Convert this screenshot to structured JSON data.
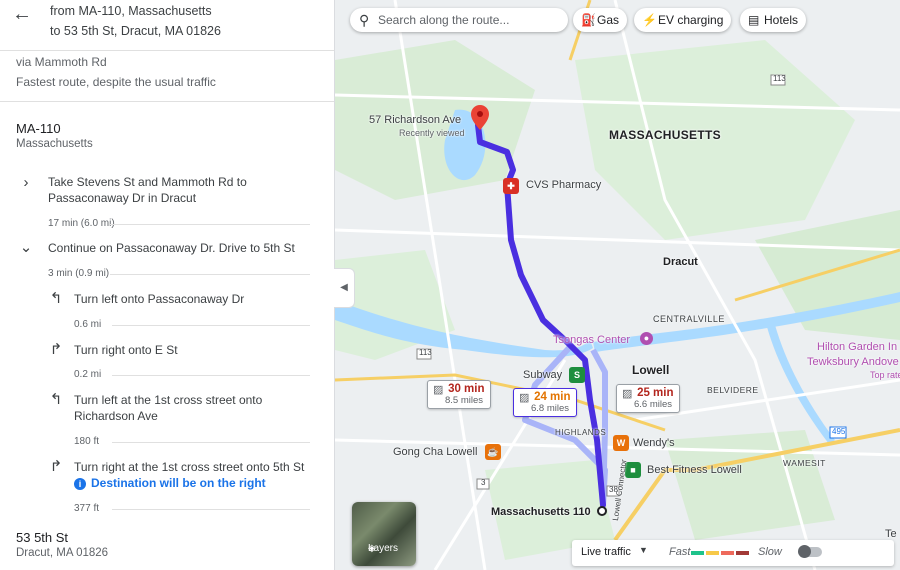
{
  "panel": {
    "back_icon": "arrow-left-icon",
    "from_text": "from MA-110, Massachusetts",
    "to_text": "to 53 5th St, Dracut, MA 01826",
    "via": "via Mammoth Rd",
    "route_note": "Fastest route, despite the usual traffic",
    "origin": {
      "title": "MA-110",
      "subtitle": "Massachusetts"
    },
    "steps": [
      {
        "icon": "chevron-right-icon",
        "text": "Take Stevens St and Mammoth Rd to Passaconaway Dr in Dracut",
        "meta": "17 min (6.0 mi)"
      },
      {
        "icon": "chevron-down-icon",
        "text": "Continue on Passaconaway Dr. Drive to 5th St",
        "meta": "3 min (0.9 mi)"
      }
    ],
    "substeps": [
      {
        "icon": "turn-left-icon",
        "text": "Turn left onto Passaconaway Dr",
        "dist": "0.6 mi"
      },
      {
        "icon": "turn-right-icon",
        "text": "Turn right onto E St",
        "dist": "0.2 mi"
      },
      {
        "icon": "turn-left-icon",
        "text": "Turn left at the 1st cross street onto Richardson Ave",
        "dist": "180 ft"
      },
      {
        "icon": "turn-right-icon",
        "text": "Turn right at the 1st cross street onto 5th St",
        "note": "Destination will be on the right",
        "dist": "377 ft"
      }
    ],
    "destination": {
      "title": "53 5th St",
      "subtitle": "Dracut, MA 01826"
    }
  },
  "map": {
    "search_placeholder": "Search along the route...",
    "chips": [
      {
        "icon": "gas-icon",
        "label": "Gas"
      },
      {
        "icon": "ev-charging-icon",
        "label": "EV charging"
      },
      {
        "icon": "hotel-icon",
        "label": "Hotels"
      }
    ],
    "labels": {
      "richardson": "57 Richardson Ave",
      "recently_viewed": "Recently viewed",
      "massachusetts": "MASSACHUSETTS",
      "cvs": "CVS Pharmacy",
      "dracut": "Dracut",
      "centralville": "CENTRALVILLE",
      "tsongas": "Tsongas Center",
      "hilton": "Hilton Garden In",
      "tewksbury": "Tewksbury Andove",
      "rate": "Top rate",
      "lowell": "Lowell",
      "subway": "Subway",
      "belvidere": "BELVIDERE",
      "highlands": "HIGHLANDS",
      "wendys": "Wendy's",
      "gongcha": "Gong Cha Lowell",
      "bestfitness": "Best Fitness Lowell",
      "wamesit": "WAMESIT",
      "mass110": "Massachusetts 110",
      "connector": "Lowell Connector",
      "te": "Te",
      "route113_a": "113",
      "route113_b": "113",
      "route3": "3",
      "route495": "495",
      "route38": "38"
    },
    "route_boxes": [
      {
        "time": "30 min",
        "miles": "8.5 miles",
        "color": "#b3261e"
      },
      {
        "time": "24 min",
        "miles": "6.8 miles",
        "color": "#e37400"
      },
      {
        "time": "25 min",
        "miles": "6.6 miles",
        "color": "#b3261e"
      }
    ],
    "layers_label": "Layers",
    "traffic": {
      "label": "Live traffic",
      "fast": "Fast",
      "slow": "Slow",
      "colors": [
        "#1ec38b",
        "#f7c948",
        "#ee6a5c",
        "#a23a37"
      ]
    },
    "colors": {
      "route": "#4a2fe0",
      "alt_route": "#a9b4f8"
    }
  }
}
